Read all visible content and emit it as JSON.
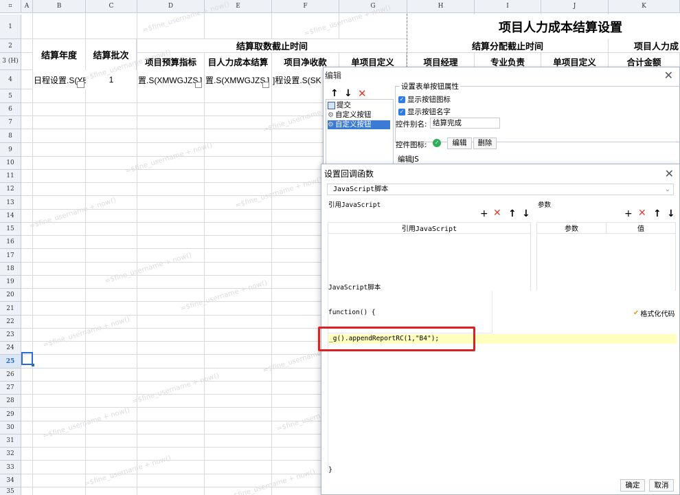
{
  "sheet": {
    "corner": "⌗",
    "columns": [
      "A",
      "B",
      "C",
      "D",
      "E",
      "F",
      "G",
      "H",
      "I",
      "J",
      "K"
    ],
    "rows": [
      "1",
      "2",
      "3 (H)",
      "4",
      "5",
      "6",
      "7",
      "8",
      "9",
      "10",
      "11",
      "12",
      "13",
      "14",
      "15",
      "16",
      "17",
      "18",
      "19",
      "20",
      "21",
      "22",
      "23",
      "24",
      "25",
      "26",
      "27",
      "28",
      "29",
      "30",
      "31",
      "32",
      "33",
      "34",
      "35"
    ],
    "title": "项目人力成本结算设置",
    "header_year": "结算年度",
    "header_batch": "结算批次",
    "header_cutoff": "结算取数截止时间",
    "header_alloc": "结算分配截止时间",
    "header_hr_partial": "项目人力成",
    "sub_headers": [
      "项目预算指标",
      "目人力成本结算",
      "项目净收款",
      "单项目定义",
      "项目经理",
      "专业负责",
      "单项目定义",
      "合计金额"
    ],
    "row4": {
      "b": "日程设置.S(YE",
      "c": "1",
      "d": "置.S(XMWGJZSJ",
      "e": "置.S(XMWGJZSJ",
      "f": "]程设置.S(SK"
    },
    "watermark": "=$fine_username + now()"
  },
  "edit_dialog": {
    "title": "编辑",
    "toolbar": {
      "up": "↑",
      "down": "↓",
      "delete": "✕"
    },
    "tree": [
      "提交",
      "自定义按钮",
      "自定义按钮"
    ],
    "group_caption": "设置表单按钮属性",
    "show_icon": "显示按钮图标",
    "show_name": "显示按钮名字",
    "alias_label": "控件别名:",
    "alias_value": "结算完成",
    "icon_label": "控件图标:",
    "edit_btn": "编辑",
    "delete_btn": "删除",
    "edit_js": "编辑JS"
  },
  "callback_dialog": {
    "title": "设置回调函数",
    "type_select": "JavaScript脚本",
    "ref_js_caption": "引用JavaScript",
    "params_caption": "参数",
    "ref_js_col": "引用JavaScript",
    "param_col": "参数",
    "value_col": "值",
    "script_caption": "JavaScript脚本",
    "func_open": "function() {",
    "format_code": "格式化代码",
    "code_line": "_g().appendReportRC(1,\"B4\");",
    "func_close": "}",
    "ok": "确定",
    "cancel": "取消"
  },
  "colors": {
    "accent": "#3a7bd5",
    "highlight_box": "#e02020",
    "code_line_bg": "#ffffc0",
    "add": "#333333",
    "remove": "#e03b2b"
  }
}
